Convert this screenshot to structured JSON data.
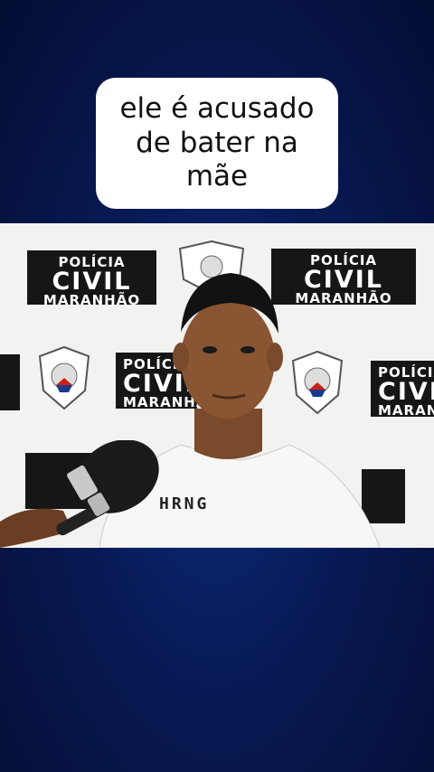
{
  "caption": {
    "text": "ele é acusado de bater na mãe"
  },
  "video": {
    "backdrop_logo": {
      "line1": "POLÍCIA",
      "line2": "CIVIL",
      "line3": "MARANHÃO"
    },
    "badge_label": "POLÍCIA CIVIL",
    "badge_sub": "MARANHÃO",
    "shirt_text": "HRNG"
  },
  "colors": {
    "background_top": "#040d33",
    "background_mid": "#0d2a7a",
    "caption_bg": "#ffffff",
    "logo_bg": "#161616"
  },
  "icons": [
    "microphone-icon",
    "police-badge-icon"
  ]
}
